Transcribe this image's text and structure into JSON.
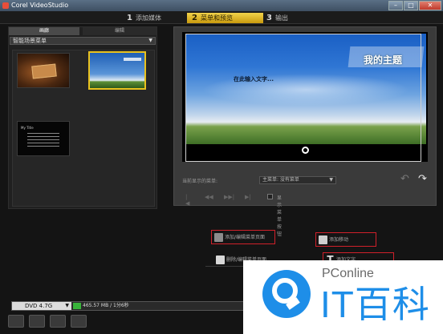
{
  "window": {
    "title": "Corel VideoStudio",
    "controls": [
      "–",
      "□",
      "✕"
    ]
  },
  "steps": [
    {
      "num": "1",
      "label": "添加媒体"
    },
    {
      "num": "2",
      "label": "菜单和预览"
    },
    {
      "num": "3",
      "label": "输出"
    }
  ],
  "left_panel": {
    "tabs": {
      "gallery": "画廊",
      "edit": "编辑"
    },
    "template_category": "智能场景菜单",
    "thumb3_heading": "My Title"
  },
  "preview": {
    "theme_title": "我的主题",
    "text_placeholder": "在此输入文字...",
    "current_menu_label": "当前显示的菜单:",
    "current_menu_value": "主菜单: 没有菜单",
    "show_checkbox_label": "显示菜单按钮",
    "nav_buttons": [
      "|◀",
      "◀◀",
      "▶▶|",
      "▶|"
    ]
  },
  "actions": {
    "add_menu": "添加/编辑菜单页面",
    "delete_menu": "删除/编辑菜单页面",
    "add_motion": "添加移动",
    "add_text": "添加文字"
  },
  "bottom": {
    "disc_type": "DVD 4.7G",
    "disc_usage": "465.57 MB / 1分6秒",
    "icons": [
      "settings-icon",
      "gear-icon",
      "hdv-icon",
      "printer-icon"
    ]
  },
  "watermark": {
    "brand": "PConline",
    "brand_cn": "IT百科"
  },
  "colors": {
    "accent_step": "#e9c21e",
    "highlight_box": "#d0202a",
    "brand_blue": "#1e8ee8"
  }
}
